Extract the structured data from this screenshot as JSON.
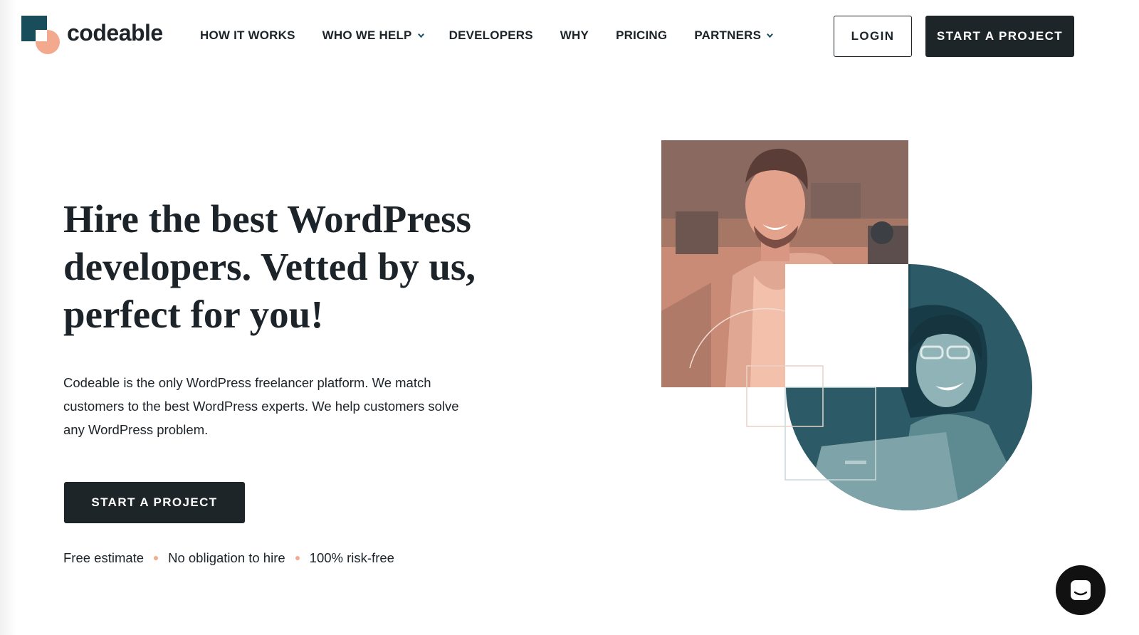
{
  "brand": {
    "name": "codeable",
    "colors": {
      "dark": "#1a4d5c",
      "peach": "#f3a98e",
      "ink": "#1c2329"
    }
  },
  "nav": {
    "items": [
      {
        "label": "HOW IT WORKS",
        "has_dropdown": false
      },
      {
        "label": "WHO WE HELP",
        "has_dropdown": true
      },
      {
        "label": "DEVELOPERS",
        "has_dropdown": false
      },
      {
        "label": "WHY",
        "has_dropdown": false
      },
      {
        "label": "PRICING",
        "has_dropdown": false
      },
      {
        "label": "PARTNERS",
        "has_dropdown": true
      }
    ],
    "login_label": "LOGIN",
    "start_label": "START A PROJECT"
  },
  "hero": {
    "title": "Hire the best WordPress developers. Vetted by us, perfect for you!",
    "description": "Codeable is the only WordPress freelancer platform. We match customers to the best WordPress experts. We help customers solve any WordPress problem.",
    "cta_label": "START A PROJECT",
    "perks": [
      "Free estimate",
      "No obligation to hire",
      "100% risk-free"
    ]
  },
  "chat": {
    "icon": "chat-icon"
  }
}
